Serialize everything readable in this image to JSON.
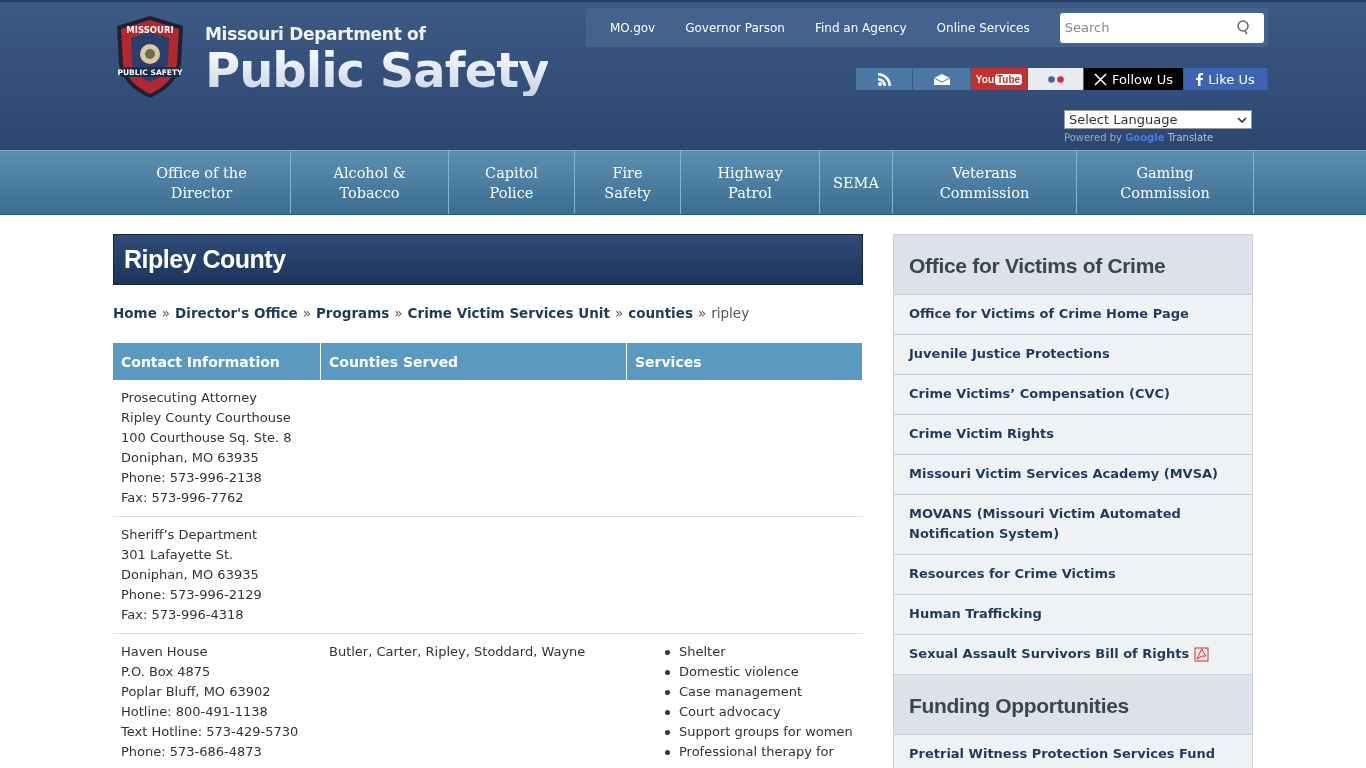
{
  "logo": {
    "badge_top": "MISSOURI",
    "badge_bottom": "PUBLIC SAFETY",
    "line1": "Missouri Department of",
    "line2": "Public Safety"
  },
  "top_links": [
    "MO.gov",
    "Governor Parson",
    "Find an Agency",
    "Online Services"
  ],
  "search": {
    "placeholder": "Search"
  },
  "social": [
    {
      "kind": "rss"
    },
    {
      "kind": "email"
    },
    {
      "kind": "youtube",
      "label": "You",
      "label2": "Tube"
    },
    {
      "kind": "flickr"
    },
    {
      "kind": "x",
      "label": "Follow Us"
    },
    {
      "kind": "facebook",
      "label": "Like Us"
    }
  ],
  "language": {
    "value": "Select Language",
    "powered": "Powered by",
    "google": "Google",
    "translate": "Translate"
  },
  "nav": [
    {
      "label": "Office of the Director"
    },
    {
      "label": "Alcohol & Tobacco"
    },
    {
      "label": "Capitol Police"
    },
    {
      "label": "Fire Safety"
    },
    {
      "label": "Highway Patrol"
    },
    {
      "label": "SEMA"
    },
    {
      "label": "Veterans Commission"
    },
    {
      "label": "Gaming Commission"
    }
  ],
  "page_title": "Ripley County",
  "breadcrumb": [
    {
      "label": "Home",
      "link": true
    },
    {
      "label": "Director's Office",
      "link": true
    },
    {
      "label": "Programs",
      "link": true
    },
    {
      "label": "Crime Victim Services Unit",
      "link": true
    },
    {
      "label": "counties",
      "link": true
    },
    {
      "label": "ripley",
      "link": false
    }
  ],
  "breadcrumb_separator": "»",
  "table": {
    "columns": [
      "Contact Information",
      "Counties Served",
      "Services"
    ],
    "rows": [
      {
        "contact": [
          "Prosecuting Attorney",
          "Ripley County Courthouse",
          "100 Courthouse Sq. Ste. 8",
          "Doniphan, MO 63935",
          "Phone: 573-996-2138",
          "Fax: 573-996-7762"
        ]
      },
      {
        "contact": [
          "Sheriff’s Department",
          "301 Lafayette St.",
          "Doniphan, MO 63935",
          "Phone: 573-996-2129",
          "Fax: 573-996-4318"
        ]
      },
      {
        "contact": [
          "Haven House",
          "P.O. Box 4875",
          "Poplar Bluff, MO 63902",
          "Hotline: 800-491-1138",
          "Text Hotline: 573-429-5730",
          "Phone: 573-686-4873"
        ],
        "counties": "Butler, Carter, Ripley, Stoddard, Wayne",
        "services": [
          "Shelter",
          "Domestic violence",
          "Case management",
          "Court advocacy",
          "Support groups for women",
          "Professional therapy for"
        ]
      }
    ]
  },
  "sidebar": [
    {
      "title": "Office for Victims of Crime",
      "links": [
        {
          "label": "Office for Victims of Crime Home Page"
        },
        {
          "label": "Juvenile Justice Protections"
        },
        {
          "label": "Crime Victims’ Compensation (CVC)"
        },
        {
          "label": "Crime Victim Rights"
        },
        {
          "label": "Missouri Victim Services Academy (MVSA)"
        },
        {
          "label": "MOVANS (Missouri Victim Automated Notification System)"
        },
        {
          "label": "Resources for Crime Victims"
        },
        {
          "label": "Human Trafficking"
        },
        {
          "label": "Sexual Assault Survivors Bill of Rights",
          "pdf": true
        }
      ]
    },
    {
      "title": "Funding Opportunities",
      "links": [
        {
          "label": "Pretrial Witness Protection Services Fund"
        }
      ]
    }
  ]
}
